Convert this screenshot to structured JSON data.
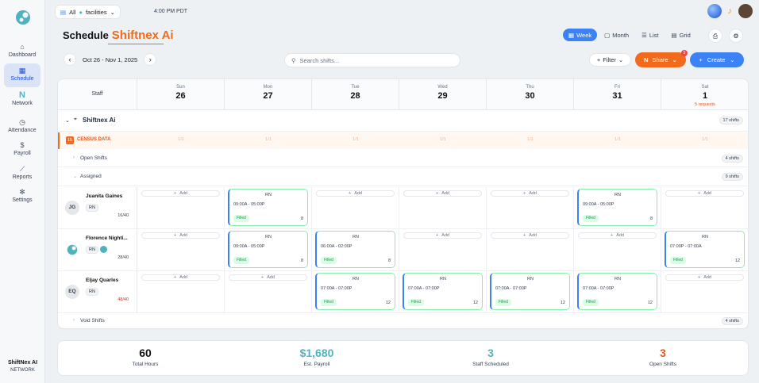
{
  "sidebar": {
    "items": [
      {
        "label": "Dashboard",
        "icon": "home-icon"
      },
      {
        "label": "Schedule",
        "icon": "calendar-icon",
        "active": true
      },
      {
        "label": "Network",
        "icon": "network-logo-icon"
      },
      {
        "label": "Attendance",
        "icon": "clock-icon"
      },
      {
        "label": "Payroll",
        "icon": "dollar-icon"
      },
      {
        "label": "Reports",
        "icon": "chart-icon"
      },
      {
        "label": "Settings",
        "icon": "gear-icon"
      }
    ],
    "brand": "ShiftNex AI",
    "brand_sub": "NETWORK"
  },
  "topbar": {
    "facility": "All",
    "facility_sub": "facilities",
    "time": "4:00 PM PDT"
  },
  "page": {
    "title": "Schedule",
    "title_accent": "Shiftnex Ai"
  },
  "views": {
    "week": "Week",
    "month": "Month",
    "list": "List",
    "grid": "Grid"
  },
  "toolbar": {
    "date_range": "Oct 26 - Nov 1, 2025",
    "search_placeholder": "Search shifts...",
    "filter": "Filter",
    "share": "Share",
    "share_badge": "5",
    "create": "Create"
  },
  "grid": {
    "staff_header": "Staff",
    "days": [
      {
        "name": "Sun",
        "date": "26"
      },
      {
        "name": "Mon",
        "date": "27"
      },
      {
        "name": "Tue",
        "date": "28"
      },
      {
        "name": "Wed",
        "date": "29"
      },
      {
        "name": "Thu",
        "date": "30"
      },
      {
        "name": "Fri",
        "date": "31"
      },
      {
        "name": "Sat",
        "date": "1",
        "requests": "5 requests"
      }
    ],
    "facility": {
      "name": "Shiftnex Ai",
      "count": "17 shifts"
    },
    "census": {
      "badge": "15",
      "label": "CENSUS DATA",
      "values": [
        "1/1",
        "1/1",
        "1/1",
        "1/1",
        "1/1",
        "1/1",
        "1/1"
      ]
    },
    "open_shifts": {
      "label": "Open Shifts",
      "count": "4 shifts"
    },
    "assigned": {
      "label": "Assigned",
      "count": "9 shifts"
    },
    "void_shifts": {
      "label": "Void Shifts",
      "count": "4 shifts"
    },
    "add_label": "Add",
    "staff": [
      {
        "initials": "JG",
        "name": "Juanita Gaines",
        "role": "RN",
        "hours": "16/40",
        "hours_red": false,
        "shifts": [
          null,
          {
            "role": "RN",
            "time": "09:00A - 05:00P",
            "status": "Filled",
            "n": "8"
          },
          null,
          null,
          null,
          {
            "role": "RN",
            "time": "09:00A - 05:00P",
            "status": "Filled",
            "n": "8"
          },
          null
        ]
      },
      {
        "initials": "",
        "name": "Florence Nighti...",
        "role": "RN",
        "hours": "28/40",
        "hours_red": false,
        "shifts": [
          null,
          {
            "role": "RN",
            "time": "09:00A - 05:00P",
            "status": "Filled",
            "n": "8"
          },
          {
            "role": "RN",
            "time": "06:00A - 02:00P",
            "status": "Filled",
            "n": "8"
          },
          null,
          null,
          null,
          {
            "role": "RN",
            "time": "07:00P - 07:00A",
            "status": "Filled",
            "n": "12"
          }
        ]
      },
      {
        "initials": "EQ",
        "name": "Eljay Quarles",
        "role": "RN",
        "hours": "48/40",
        "hours_red": true,
        "shifts": [
          null,
          null,
          {
            "role": "RN",
            "time": "07:00A - 07:00P",
            "status": "Filled",
            "n": "12"
          },
          {
            "role": "RN",
            "time": "07:00A - 07:00P",
            "status": "Filled",
            "n": "12"
          },
          {
            "role": "RN",
            "time": "07:00A - 07:00P",
            "status": "Filled",
            "n": "12"
          },
          {
            "role": "RN",
            "time": "07:00A - 07:00P",
            "status": "Filled",
            "n": "12"
          },
          null
        ]
      }
    ]
  },
  "stats": [
    {
      "value": "60",
      "label": "Total Hours",
      "color": "#111111"
    },
    {
      "value": "$1,680",
      "label": "Est. Payroll",
      "color": "#4fb3bf"
    },
    {
      "value": "3",
      "label": "Staff Scheduled",
      "color": "#4fb3bf"
    },
    {
      "value": "3",
      "label": "Open Shifts",
      "color": "#e4571f"
    }
  ],
  "colors": {
    "accent": "#f26b1d",
    "primary": "#3b82f6",
    "teal": "#4fb3bf"
  }
}
